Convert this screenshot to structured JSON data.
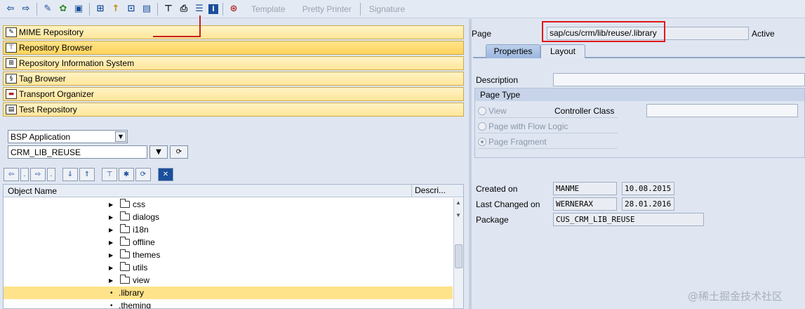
{
  "toolbar": {
    "icons": [
      "back-arrow-icon",
      "forward-arrow-icon",
      "edit-pencil-icon",
      "activate-icon",
      "object-list-icon",
      "hierarchy-icon",
      "where-used-icon",
      "other-object-icon",
      "display-icon",
      "navigation-tree-icon",
      "print-icon",
      "list-view-icon",
      "info-icon",
      "test-icon"
    ],
    "template_label": "Template",
    "pretty_printer_label": "Pretty Printer",
    "signature_label": "Signature"
  },
  "nav": {
    "mime": "MIME Repository",
    "repo_browser": "Repository Browser",
    "repo_info": "Repository Information System",
    "tag": "Tag Browser",
    "transport": "Transport Organizer",
    "test": "Test Repository"
  },
  "browser": {
    "object_type": "BSP Application",
    "object_name": "CRM_LIB_REUSE"
  },
  "tree": {
    "col_object": "Object Name",
    "col_desc": "Descri...",
    "folders": [
      "css",
      "dialogs",
      "i18n",
      "offline",
      "themes",
      "utils",
      "view"
    ],
    "files": [
      ".library",
      ".theming"
    ]
  },
  "detail": {
    "page_label": "Page",
    "page_value": "sap/cus/crm/lib/reuse/.library",
    "status": "Active",
    "tab_properties": "Properties",
    "tab_layout": "Layout",
    "description_label": "Description",
    "description_value": "",
    "page_type_title": "Page Type",
    "radio_view": "View",
    "controller_class_label": "Controller Class",
    "controller_class_value": "",
    "radio_flow_logic": "Page with Flow Logic",
    "radio_fragment": "Page Fragment",
    "created_on_label": "Created on",
    "created_by": "MANME",
    "created_date": "10.08.2015",
    "last_changed_label": "Last Changed on",
    "changed_by": "WERNERAX",
    "changed_date": "28.01.2016",
    "package_label": "Package",
    "package_value": "CUS_CRM_LIB_REUSE"
  },
  "watermark": "@稀土掘金技术社区",
  "colors": {
    "highlight": "#ffe38a",
    "annotation_red": "#e01818"
  }
}
